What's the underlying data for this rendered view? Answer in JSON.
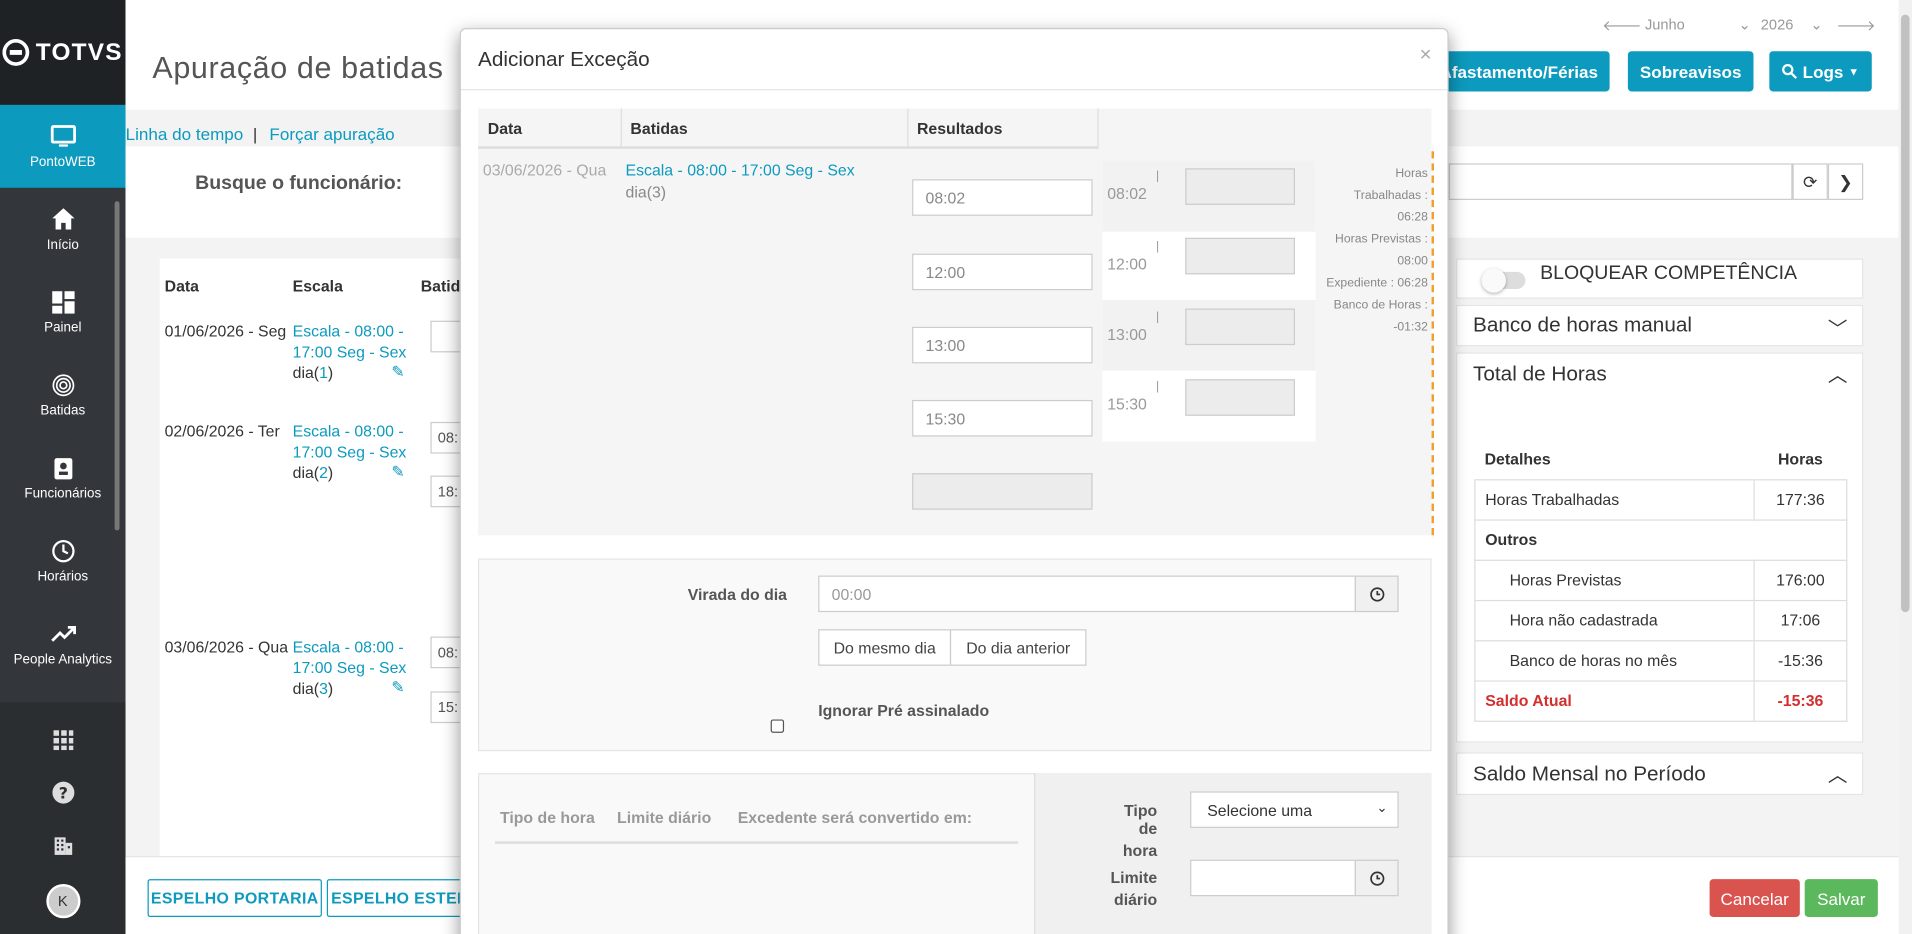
{
  "brand": {
    "name": "TOTVS"
  },
  "sidebar": {
    "items": [
      {
        "label": "PontoWEB"
      },
      {
        "label": "Início"
      },
      {
        "label": "Painel"
      },
      {
        "label": "Batidas"
      },
      {
        "label": "Funcionários"
      },
      {
        "label": "Horários"
      },
      {
        "label": "People Analytics"
      }
    ],
    "avatar": "K"
  },
  "header": {
    "title": "Apuração de batidas",
    "month": "Junho",
    "year": "2026",
    "buttons": {
      "afastamento": "Afastamento/Férias",
      "sobreavisos": "Sobreavisos",
      "logs": "Logs"
    }
  },
  "links": {
    "linha": "Linha do tempo",
    "separator": "|",
    "forcar": "Forçar apuração"
  },
  "search": {
    "label": "Busque o funcionário:"
  },
  "grid": {
    "headers": {
      "data": "Data",
      "escala": "Escala",
      "batidas": "Batida"
    },
    "rows": [
      {
        "date": "01/06/2026 - Seg",
        "escala": "Escala - 08:00 - 17:00 Seg - Sex",
        "dia": "dia(",
        "num": "1",
        "close": ")"
      },
      {
        "date": "02/06/2026 - Ter",
        "escala": "Escala - 08:00 - 17:00 Seg - Sex",
        "dia": "dia(",
        "num": "2",
        "close": ")",
        "in1": "08:",
        "in2": "18:"
      },
      {
        "date": "03/06/2026 - Qua",
        "escala": "Escala - 08:00 - 17:00 Seg - Sex",
        "dia": "dia(",
        "num": "3",
        "close": ")",
        "in1": "08:",
        "in2": "15:"
      }
    ]
  },
  "right_panel": {
    "bloquear": "BLOQUEAR COMPETÊNCIA",
    "banco_manual": "Banco de horas manual",
    "total_horas": "Total de Horas",
    "table": {
      "head": {
        "detalhes": "Detalhes",
        "horas": "Horas"
      },
      "trabalhadas": {
        "label": "Horas Trabalhadas",
        "value": "177:36"
      },
      "outros": "Outros",
      "previstas": {
        "label": "Horas Previstas",
        "value": "176:00"
      },
      "nao_cadastrada": {
        "label": "Hora não cadastrada",
        "value": "17:06"
      },
      "banco_mes": {
        "label": "Banco de horas no mês",
        "value": "-15:36"
      },
      "saldo": {
        "label": "Saldo Atual",
        "value": "-15:36"
      }
    },
    "saldo_mensal": "Saldo Mensal no Período"
  },
  "bottom": {
    "espelho_portaria": "ESPELHO PORTARIA",
    "espelho_estendido": "ESPELHO ESTEN",
    "cancelar": "Cancelar",
    "salvar": "Salvar"
  },
  "modal": {
    "title": "Adicionar Exceção",
    "close": "×",
    "headers": {
      "data": "Data",
      "batidas": "Batidas",
      "resultados": "Resultados"
    },
    "row": {
      "date": "03/06/2026 - Qua",
      "escala": "Escala - 08:00 - 17:00 Seg - Sex",
      "dia": "dia(3)"
    },
    "batidas": [
      "08:02",
      "12:00",
      "13:00",
      "15:30"
    ],
    "resultados": [
      "08:02",
      "12:00",
      "13:00",
      "15:30"
    ],
    "tick": "|",
    "info": {
      "trab_label": "Horas",
      "trab_label2": "Trabalhadas :",
      "trab": "06:28",
      "prev_label": "Horas Previstas :",
      "prev": "08:00",
      "exp": "Expediente : 06:28",
      "banco_label": "Banco de Horas :",
      "banco": "-01:32"
    },
    "virada": {
      "label": "Virada do dia",
      "placeholder": "00:00",
      "mesmo": "Do mesmo dia",
      "anterior": "Do dia anterior"
    },
    "ignorar": "Ignorar Pré assinalado",
    "tipos": {
      "tipo_hora": "Tipo de hora",
      "limite": "Limite diário",
      "excedente": "Excedente será convertido em:"
    },
    "form": {
      "tipo_label1": "Tipo de",
      "tipo_label2": "hora",
      "selecione": "Selecione uma",
      "limite_label1": "Limite",
      "limite_label2": "diário"
    }
  }
}
